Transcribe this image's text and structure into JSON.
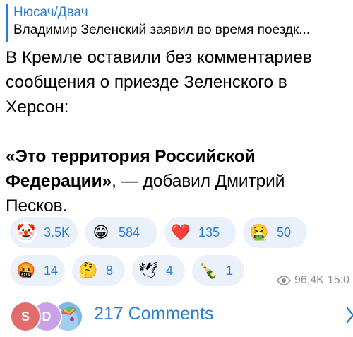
{
  "reply": {
    "author": "Нюсач/Двач",
    "text": "Владимир Зеленский заявил во время поездк..."
  },
  "message": {
    "line1": "В Кремле оставили без комментариев сообщения о приезде Зеленского в Херсон:",
    "quote_bold": "«Это территория Российской Федерации»",
    "quote_tail": ", — добавил Дмитрий Песков."
  },
  "reactions": [
    {
      "emoji": "🤡",
      "count": "3.5K",
      "name": "clown-face-icon"
    },
    {
      "emoji": "😁",
      "count": "584",
      "name": "grinning-face-icon"
    },
    {
      "emoji": "❤️",
      "count": "135",
      "name": "red-heart-icon"
    },
    {
      "emoji": "🤮",
      "count": "50",
      "name": "vomiting-face-icon"
    },
    {
      "emoji": "🤬",
      "count": "14",
      "name": "cursing-face-icon"
    },
    {
      "emoji": "🤔",
      "count": "8",
      "name": "thinking-face-icon"
    },
    {
      "emoji": "🕊",
      "count": "4",
      "name": "dove-icon"
    },
    {
      "emoji": "🍾",
      "count": "1",
      "name": "champagne-icon"
    }
  ],
  "meta": {
    "views": "96,4K",
    "time": "15:0"
  },
  "comments": {
    "label": "217 Comments",
    "avatars": [
      {
        "letter": "S",
        "color": "#e06c6c"
      },
      {
        "letter": "D",
        "color": "#c7a2e8"
      },
      {
        "letter": "",
        "color": "#6fa8dc"
      }
    ]
  },
  "colors": {
    "accent": "#2a7fd4",
    "chip_bg": "#eaf1fb",
    "meta_text": "#8a9099"
  }
}
